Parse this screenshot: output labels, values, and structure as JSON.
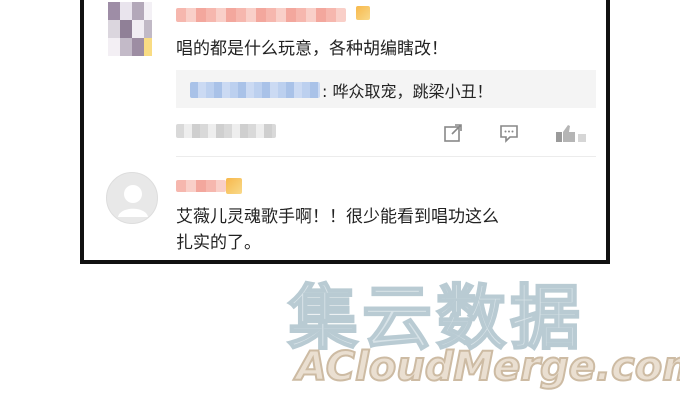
{
  "comments": [
    {
      "text": "唱的都是什么玩意，各种胡编瞎改！",
      "reply": {
        "text": ": 哗众取宠，跳梁小丑！"
      },
      "actions": [
        "share-icon",
        "comment-icon",
        "like-icon"
      ]
    },
    {
      "text_line1": "艾薇儿灵魂歌手啊！！很少能看到唱功这么",
      "text_line2": "扎实的了。"
    }
  ],
  "watermark": {
    "cn": "集云数据",
    "en": "ACloudMerge.com"
  }
}
